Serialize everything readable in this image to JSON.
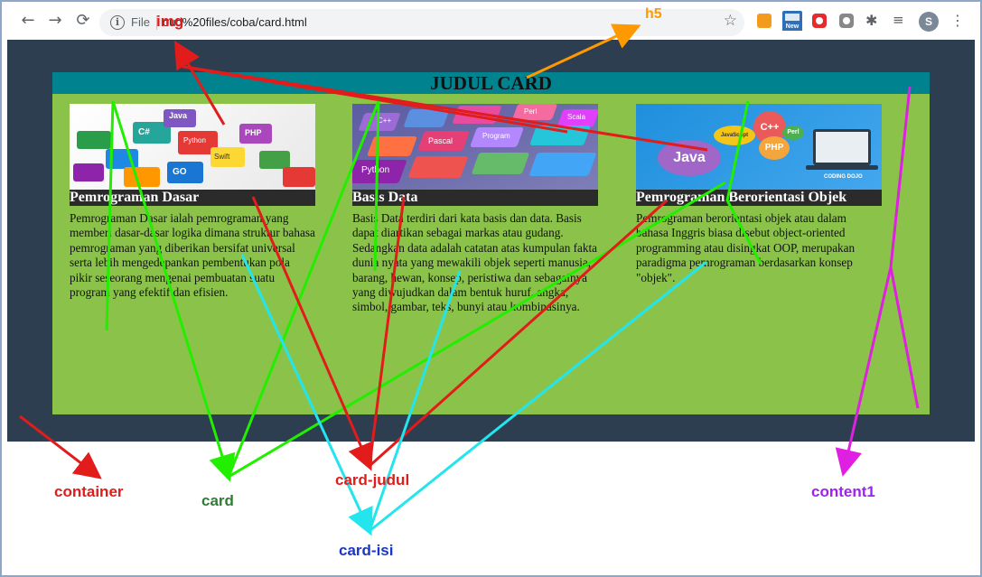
{
  "browser": {
    "back_icon": "arrow-left-icon",
    "forward_icon": "arrow-right-icon",
    "reload_icon": "reload-icon",
    "info_icon": "info-icon",
    "info_glyph": "i",
    "file_label": "File",
    "url": "oud%20files/coba/card.html",
    "star_icon": "star-icon",
    "avatar_initial": "S",
    "new_badge": "New",
    "menu_icon": "kebab-menu-icon"
  },
  "page": {
    "judul": "JUDUL CARD",
    "cards": [
      {
        "img_text": [
          "Java",
          "Python",
          "C#",
          "PHP",
          "GO",
          "Swift"
        ],
        "judul": "Pemrograman Dasar",
        "isi": "Pemrograman Dasar ialah pemrograman yang memberi dasar-dasar logika dimana struktur bahasa pemrograman yang diberikan bersifat universal serta lebih mengedepankan pembentukan pola pikir seseorang mengenai pembuatan suatu program yang efektif dan efisien."
      },
      {
        "img_text": [
          "C++",
          "Pascal",
          "Program",
          "Python",
          "Perl",
          "Scala"
        ],
        "judul": "Basis Data",
        "isi": "Basis Data terdiri dari kata basis dan data. Basis dapat diartikan sebagai markas atau gudang. Sedangkan data adalah catatan atas kumpulan fakta dunia nyata yang mewakili objek seperti manusia, barang, hewan, konsep, peristiwa dan sebagainya yang diwujudkan dalam bentuk huruf, angka, simbol, gambar, teks, bunyi atau kombinasinya."
      },
      {
        "img_text": [
          "Java",
          "C++",
          "PHP",
          "Perl",
          "JavaScript",
          "CODING DOJO"
        ],
        "judul": "Pemrograman Berorientasi Objek",
        "isi": "Pemrograman berorientasi objek atau dalam bahasa Inggris biasa disebut object-oriented programming atau disingkat OOP, merupakan paradigma pemrograman berdasarkan konsep \"objek\"."
      }
    ]
  },
  "annotations": {
    "img": "img",
    "h5": "h5",
    "container": "container",
    "card": "card",
    "card_judul": "card-judul",
    "card_isi": "card-isi",
    "content1": "content1"
  },
  "colors": {
    "container": "#2c3e50",
    "content1": "#8bc34a",
    "judul_bar": "#00838f",
    "card_judul_bg": "#2b2b2b",
    "arrow_red": "#e21b1b",
    "arrow_green": "#22ee00",
    "arrow_cyan": "#22e5ee",
    "arrow_magenta": "#e020e0",
    "arrow_orange": "#ff9900"
  }
}
